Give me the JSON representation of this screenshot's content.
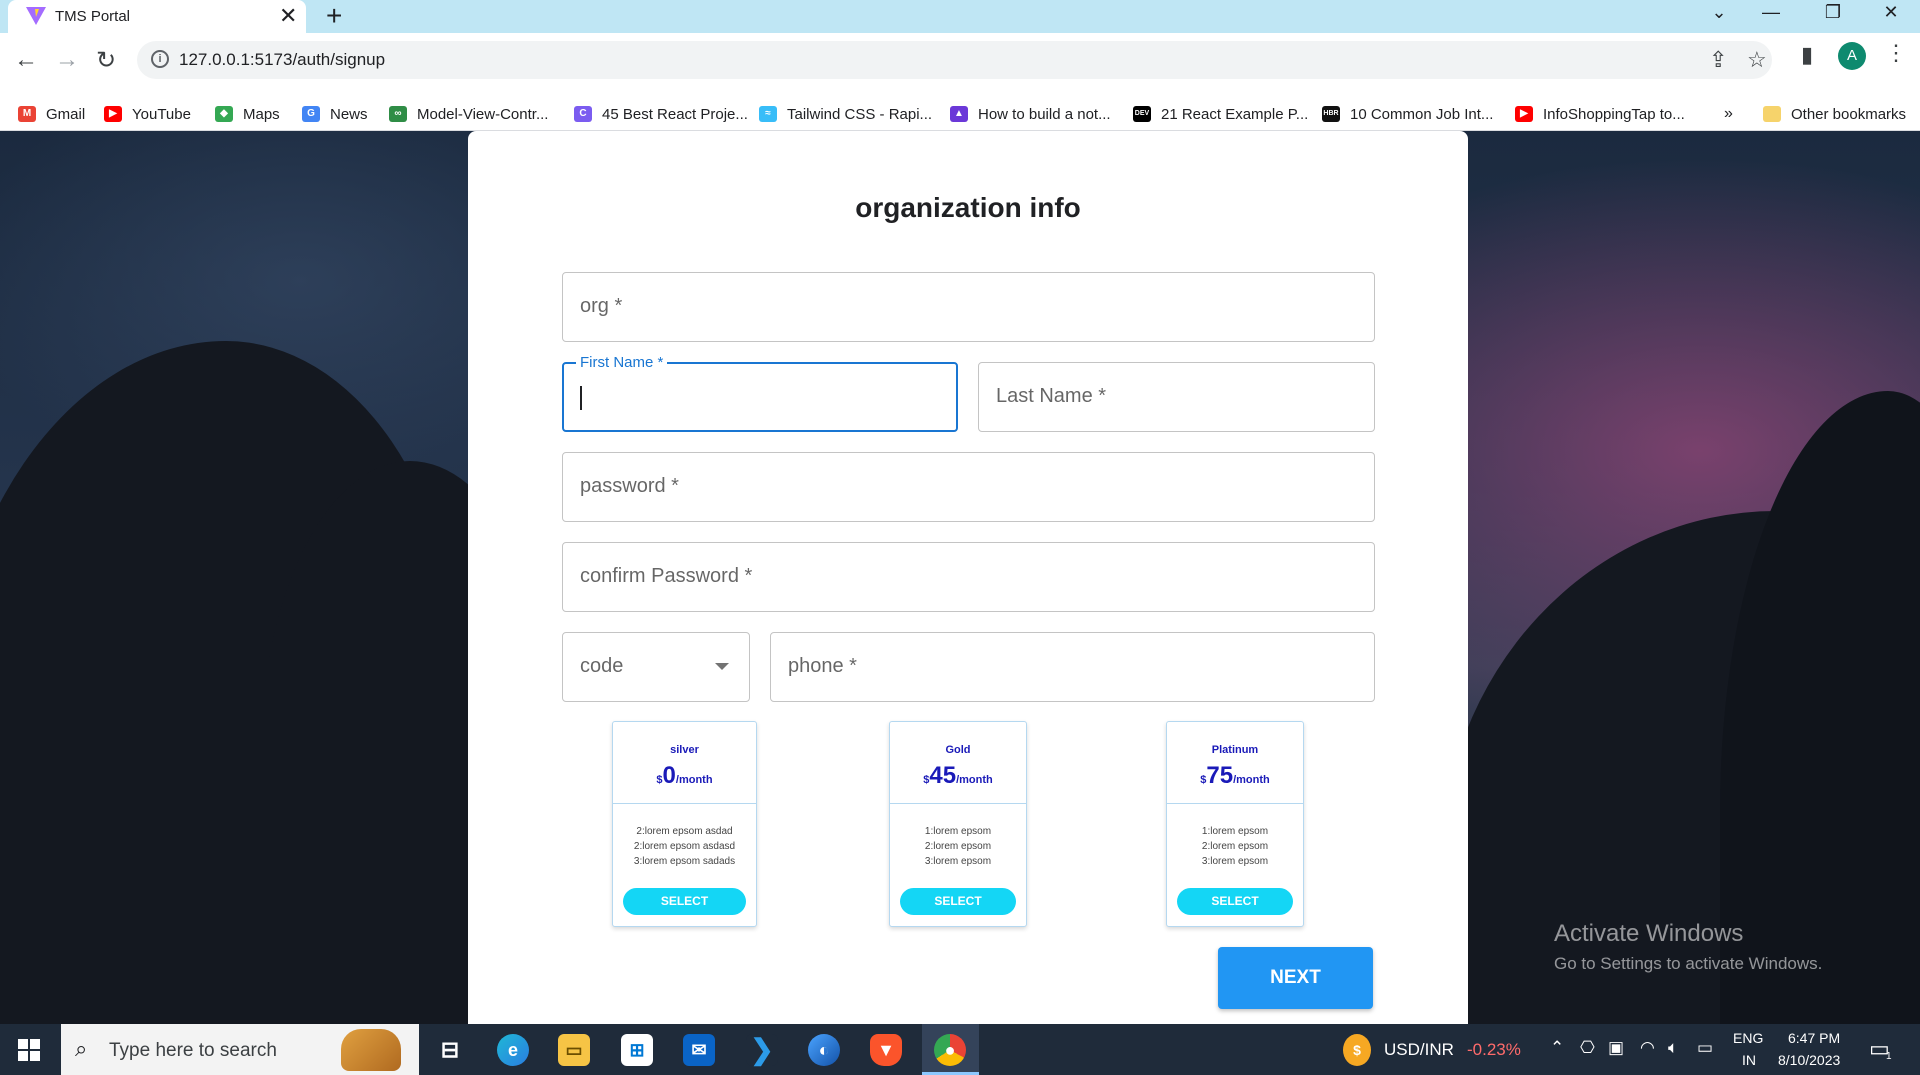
{
  "browser": {
    "tab_title": "TMS Portal",
    "tab_close": "✕",
    "new_tab": "+",
    "url": "127.0.0.1:5173/auth/signup",
    "profile_initial": "A",
    "bookmarks": [
      {
        "label": "Gmail",
        "icon": "gmail-icon",
        "color": "#ea4335",
        "glyph": "M"
      },
      {
        "label": "YouTube",
        "icon": "youtube-icon",
        "color": "#ff0000",
        "glyph": "▶"
      },
      {
        "label": "Maps",
        "icon": "maps-icon",
        "color": "#34a853",
        "glyph": "◆"
      },
      {
        "label": "News",
        "icon": "news-icon",
        "color": "#4285f4",
        "glyph": "G"
      },
      {
        "label": "Model-View-Contr...",
        "icon": "gfg-icon",
        "color": "#2f8d46",
        "glyph": "∞"
      },
      {
        "label": "45 Best React Proje...",
        "icon": "c-icon",
        "color": "#7b5cf0",
        "glyph": "C"
      },
      {
        "label": "Tailwind CSS - Rapi...",
        "icon": "tailwind-icon",
        "color": "#38bdf8",
        "glyph": "≈"
      },
      {
        "label": "How to build a not...",
        "icon": "hashnode-icon",
        "color": "#6b38d8",
        "glyph": "▲"
      },
      {
        "label": "21 React Example P...",
        "icon": "dev-icon",
        "color": "#000000",
        "glyph": "DEV"
      },
      {
        "label": "10 Common Job Int...",
        "icon": "hbr-icon",
        "color": "#111111",
        "glyph": "HBR"
      },
      {
        "label": "InfoShoppingTap to...",
        "icon": "youtube-icon",
        "color": "#ff0000",
        "glyph": "▶"
      }
    ],
    "overflow": "»",
    "other_bookmarks": "Other bookmarks"
  },
  "form": {
    "title": "organization info",
    "org_label": "org *",
    "first_name_label": "First Name *",
    "last_name_label": "Last Name *",
    "password_label": "password *",
    "confirm_password_label": "confirm Password *",
    "code_label": "code",
    "phone_label": "phone *",
    "next_label": "NEXT"
  },
  "plans": [
    {
      "name": "silver",
      "currency": "$",
      "amount": "0",
      "period": "/month",
      "features": [
        "2:lorem epsom asdad",
        "2:lorem epsom asdasd",
        "3:lorem epsom sadads"
      ],
      "button": "SELECT"
    },
    {
      "name": "Gold",
      "currency": "$",
      "amount": "45",
      "period": "/month",
      "features": [
        "1:lorem epsom",
        "2:lorem epsom",
        "3:lorem epsom"
      ],
      "button": "SELECT"
    },
    {
      "name": "Platinum",
      "currency": "$",
      "amount": "75",
      "period": "/month",
      "features": [
        "1:lorem epsom",
        "2:lorem epsom",
        "3:lorem epsom"
      ],
      "button": "SELECT"
    }
  ],
  "watermark": {
    "title": "Activate Windows",
    "subtitle": "Go to Settings to activate Windows."
  },
  "taskbar": {
    "search_placeholder": "Type here to search",
    "ticker_label": "USD/INR",
    "ticker_change": "-0.23%",
    "ticker_change_color": "#ff6b6b",
    "language": "ENG",
    "region": "IN",
    "time": "6:47 PM",
    "date": "8/10/2023",
    "notification_count": "1"
  }
}
